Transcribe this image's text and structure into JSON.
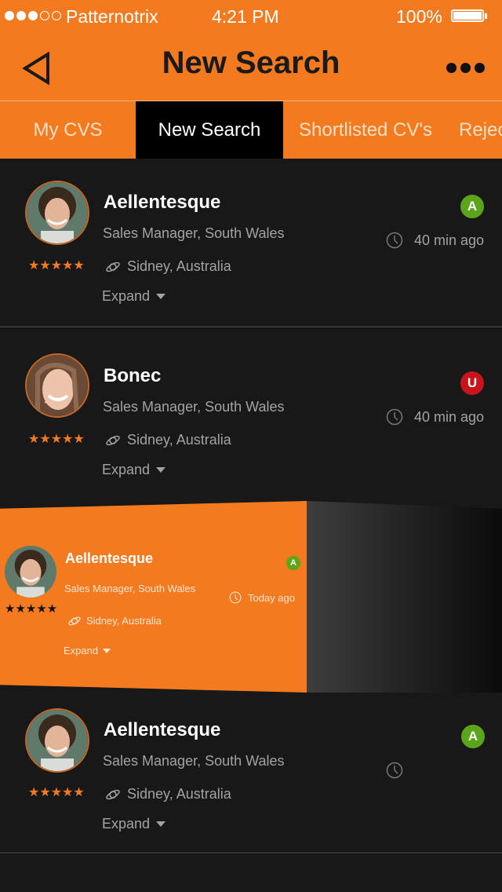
{
  "status_bar": {
    "signal_filled": 3,
    "signal_total": 5,
    "carrier": "Patternotrix",
    "time": "4:21 PM",
    "battery": "100%"
  },
  "header": {
    "title": "New Search",
    "back_icon": "back-triangle-icon",
    "more_icon": "more-dots-icon"
  },
  "tabs": [
    {
      "label": "My CVS",
      "active": false
    },
    {
      "label": "New Search",
      "active": true
    },
    {
      "label": "Shortlisted CV's",
      "active": false
    },
    {
      "label": "Rejected",
      "active": false
    }
  ],
  "colors": {
    "accent": "#f47a20",
    "background": "#181818",
    "badge_a": "#5aa51a",
    "badge_u": "#c8141a"
  },
  "cards": [
    {
      "name": "Aellentesque",
      "role": "Sales Manager, South Wales",
      "location": "Sidney, Australia",
      "expand": "Expand",
      "rating": 5,
      "badge": "A",
      "time": "40 min ago"
    },
    {
      "name": "Bonec",
      "role": "Sales Manager, South Wales",
      "location": "Sidney, Australia",
      "expand": "Expand",
      "rating": 5,
      "badge": "U",
      "time": "40 min ago"
    },
    {
      "name": "Aellentesque",
      "role": "Sales Manager, South Wales",
      "location": "Sidney, Australia",
      "expand": "Expand",
      "rating": 5,
      "badge": "A",
      "time": "Today ago"
    },
    {
      "name": "Aellentesque",
      "role": "Sales Manager, South Wales",
      "location": "Sidney, Australia",
      "expand": "Expand",
      "rating": 5,
      "badge": "A",
      "time": ""
    }
  ]
}
